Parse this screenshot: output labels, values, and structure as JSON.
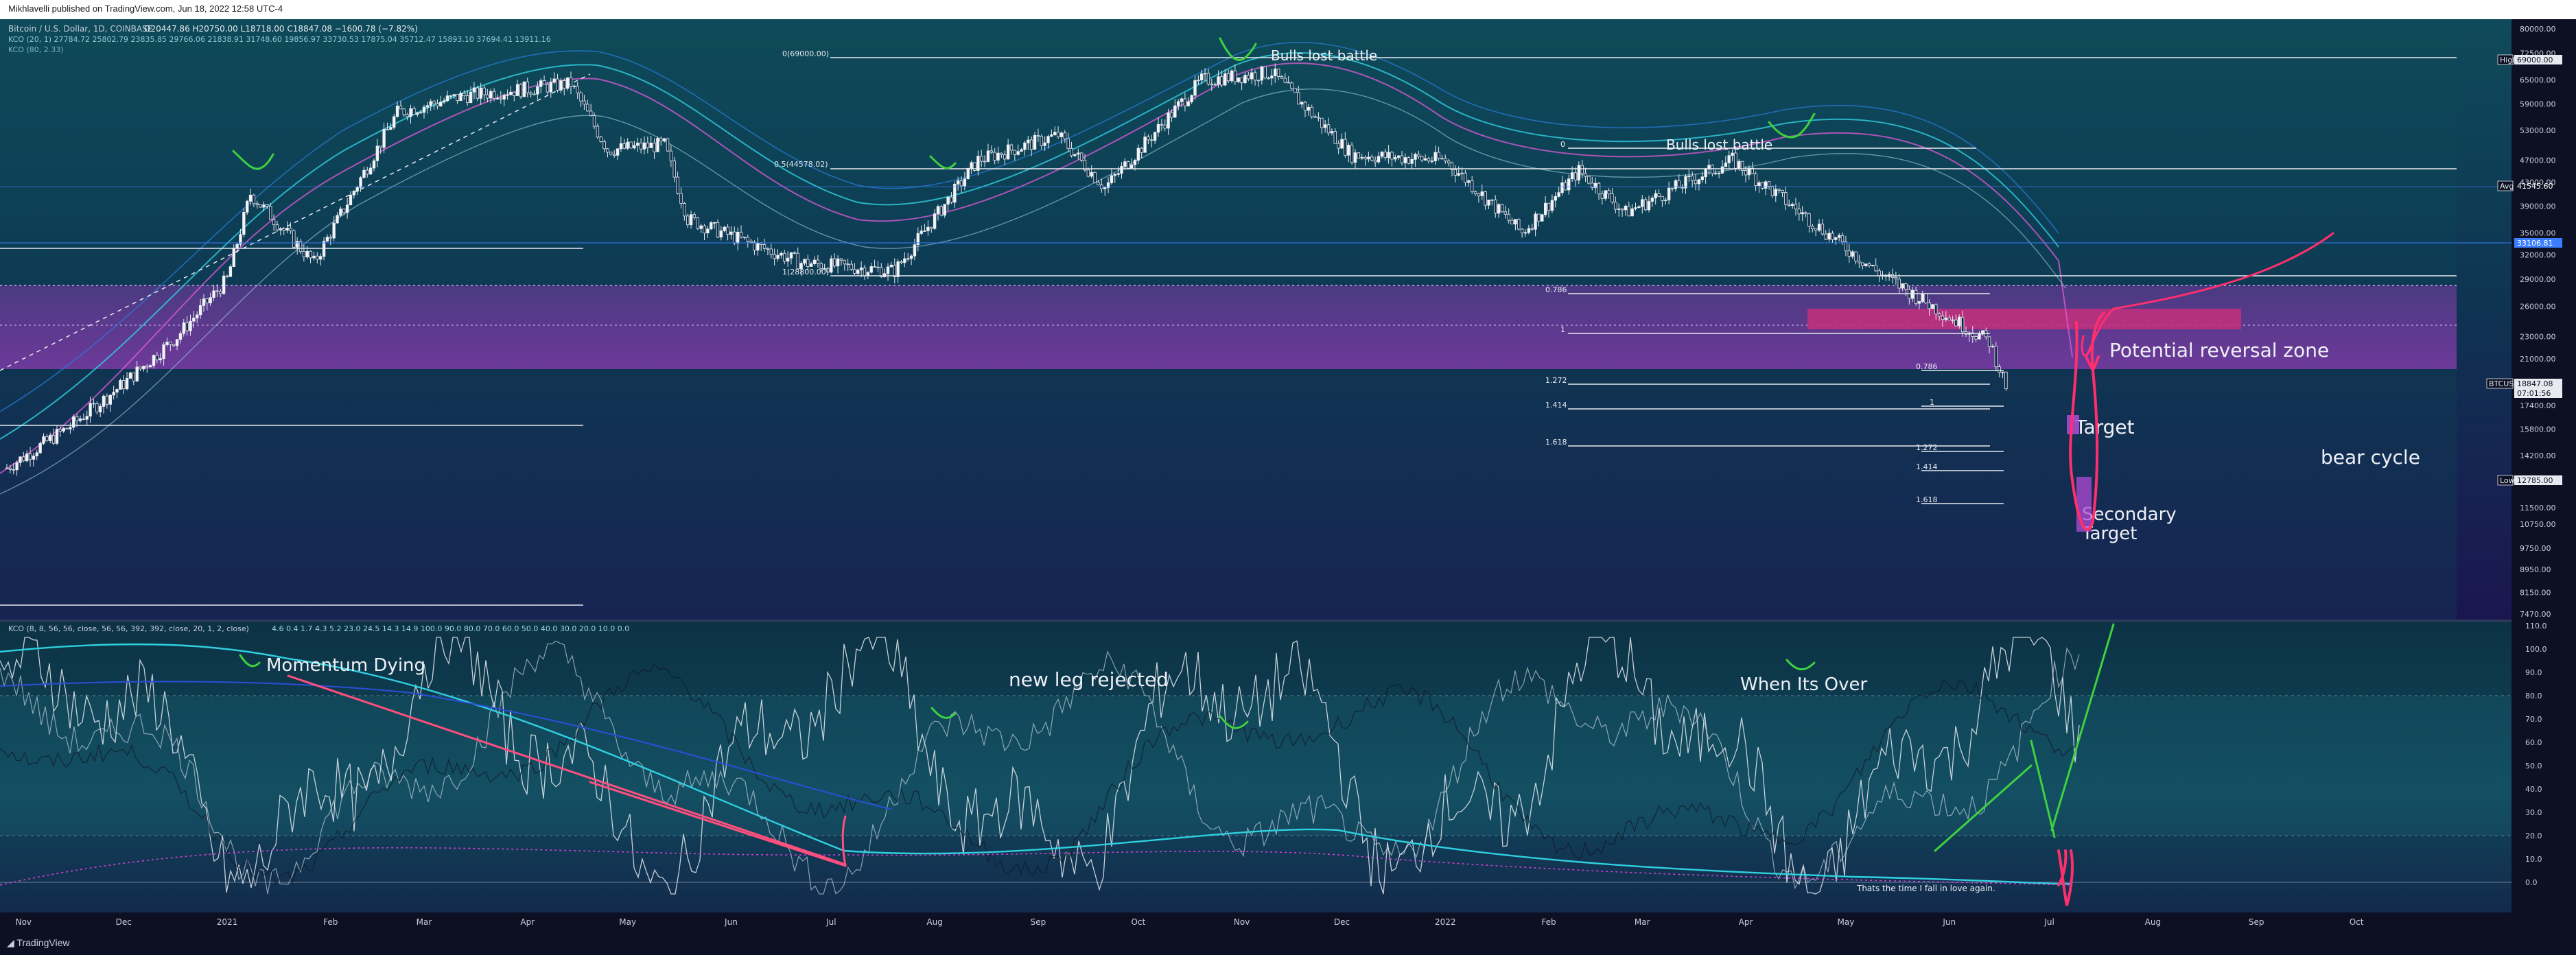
{
  "header": {
    "publisher": "Mikhlavelli published on TradingView.com, Jun 18, 2022 12:58 UTC-4",
    "symbol_line": "Bitcoin / U.S. Dollar, 1D, COINBASE",
    "ohlc": "O20447.86 H20750.00 L18718.00 C18847.08 −1600.78 (−7.82%)",
    "kco1": "KCO (20, 1)  27784.72  25802.79  23835.85  29766.06  21838.91  31748.60  19856.97  33730.53  17875.04  35712.47  15893.10  37694.41  13911.16",
    "kco2": "KCO (80, 2.33)"
  },
  "colors": {
    "background_top": "#0d3f52",
    "background_bottom": "#1a1347",
    "purple_zone": "#8a3aa8",
    "pink_zone": "#c02a7a",
    "candle": "#e8eaf0",
    "green_marks": "#3fd13f",
    "pink_marks": "#ff2f6e",
    "cyan": "#38c6e0",
    "blue": "#2a4fd8"
  },
  "chart_data": [
    {
      "type": "candlestick",
      "title": "Bitcoin / U.S. Dollar, 1D, COINBASE",
      "x_labels": [
        "Nov",
        "Dec",
        "2021",
        "Feb",
        "Mar",
        "Apr",
        "May",
        "Jun",
        "Jul",
        "Aug",
        "Sep",
        "Oct",
        "Nov",
        "Dec",
        "2022",
        "Feb",
        "Mar",
        "Apr",
        "May",
        "Jun",
        "Jul",
        "Aug",
        "Sep",
        "Oct"
      ],
      "y_scale": "log",
      "y_ticks": [
        "80000.00",
        "72500.00",
        "65000.00",
        "59000.00",
        "53000.00",
        "47000.00",
        "43000.00",
        "39000.00",
        "35000.00",
        "32000.00",
        "29000.00",
        "26000.00",
        "23000.00",
        "21000.00",
        "17400.00",
        "15800.00",
        "14200.00",
        "12800.00",
        "11500.00",
        "10750.00",
        "9750.00",
        "8950.00",
        "8150.00",
        "7470.00"
      ],
      "price_tags": [
        {
          "label": "High",
          "value": "69000.00"
        },
        {
          "label": "Avg",
          "value": "41545.60"
        },
        {
          "label": "",
          "value": "33106.81"
        },
        {
          "label": "BTCUSD",
          "value": "18847.08",
          "sub": "07:01:56"
        },
        {
          "label": "Low",
          "value": "12785.00"
        }
      ],
      "series": [
        {
          "name": "BTCUSD",
          "x": [
            "2020-10-27",
            "2020-11-15",
            "2020-12-01",
            "2020-12-17",
            "2021-01-01",
            "2021-01-08",
            "2021-01-27",
            "2021-02-21",
            "2021-03-13",
            "2021-04-14",
            "2021-04-25",
            "2021-05-12",
            "2021-05-19",
            "2021-06-22",
            "2021-07-20",
            "2021-08-14",
            "2021-09-07",
            "2021-09-21",
            "2021-10-20",
            "2021-11-10",
            "2021-12-04",
            "2022-01-01",
            "2022-01-24",
            "2022-02-10",
            "2022-02-24",
            "2022-03-28",
            "2022-05-10",
            "2022-06-13",
            "2022-06-18"
          ],
          "y": [
            13500,
            16000,
            19000,
            23000,
            29000,
            41000,
            31000,
            57000,
            61000,
            64000,
            49000,
            50000,
            37000,
            31000,
            30000,
            47000,
            52000,
            42000,
            65000,
            67000,
            48000,
            47000,
            35000,
            45000,
            38000,
            47000,
            30000,
            22500,
            18847
          ]
        }
      ],
      "horizontal_levels": [
        {
          "label": "0(69000.00)",
          "value": 69000
        },
        {
          "label": "0.5(44578.02)",
          "value": 44578.02
        },
        {
          "label": "1(28800.00)",
          "value": 28800
        }
      ],
      "fib_labels": [
        "0",
        "0.786",
        "1",
        "1.272",
        "1.414",
        "1.618",
        "0.786",
        "1",
        "1.272",
        "1.414",
        "1.618"
      ],
      "annotations": [
        "Bulls lost battle",
        "Bulls lost battle",
        "Potential reversal zone",
        "Target",
        "Secondary\nTarget",
        "bear cycle"
      ]
    },
    {
      "type": "line",
      "title": "KCO (8, 8, 56, 56, close, 56, 56, 392, 392, close, 20, 1, 2, close)",
      "values_line": "4.6  0.4  1.7  4.3  5.2  23.0  24.5  14.3  14.9  100.0  90.0  80.0  70.0  60.0  50.0  40.0  30.0  20.0  10.0  0.0",
      "x_labels": [
        "Nov",
        "Dec",
        "2021",
        "Feb",
        "Mar",
        "Apr",
        "May",
        "Jun",
        "Jul",
        "Aug",
        "Sep",
        "Oct",
        "Nov",
        "Dec",
        "2022",
        "Feb",
        "Mar",
        "Apr",
        "May",
        "Jun",
        "Jul",
        "Aug",
        "Sep",
        "Oct"
      ],
      "y_ticks": [
        "110.0",
        "100.0",
        "90.0",
        "80.0",
        "70.0",
        "60.0",
        "50.0",
        "40.0",
        "30.0",
        "20.0",
        "10.0",
        "0.0"
      ],
      "ylim": [
        -10,
        110
      ],
      "annotations": [
        "Momentum Dying",
        "new leg rejected",
        "When Its Over",
        "Thats the time I fall in love again."
      ]
    }
  ],
  "footer": {
    "brand": "TradingView"
  }
}
